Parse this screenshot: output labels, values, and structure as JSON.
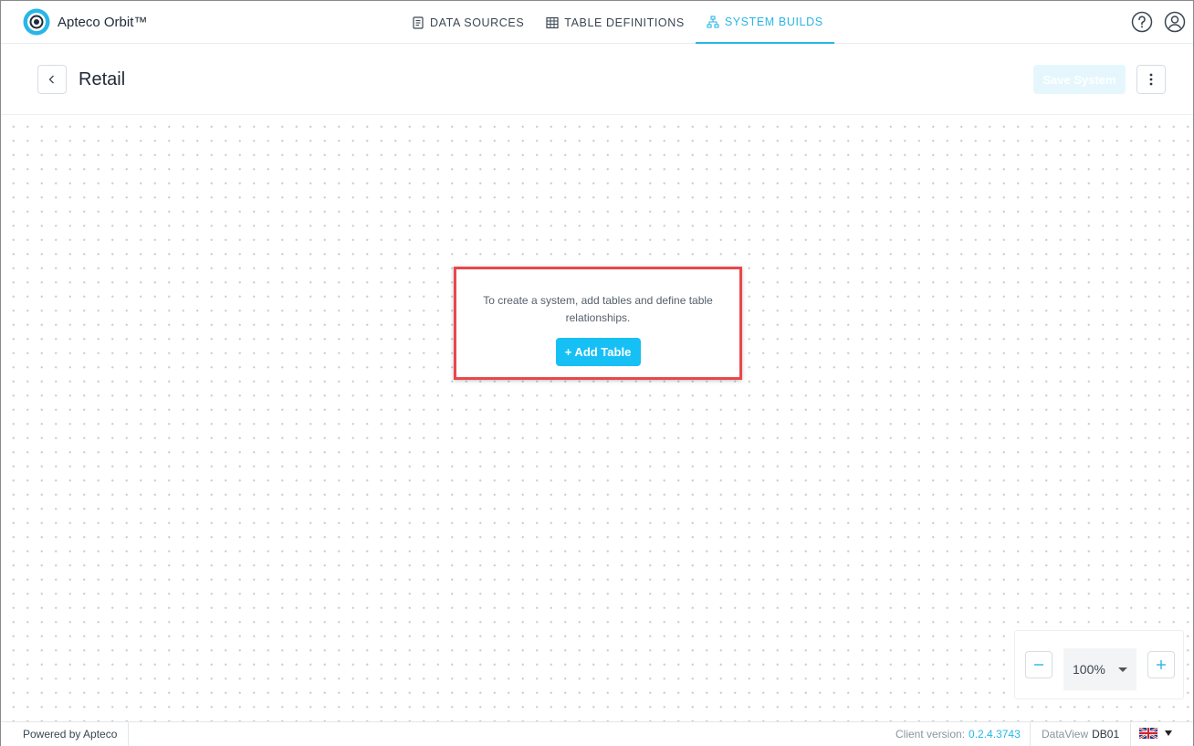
{
  "app": {
    "name": "Apteco Orbit™",
    "brand_color": "#29b6e6"
  },
  "nav": {
    "items": [
      {
        "label": "DATA SOURCES",
        "icon": "document-icon"
      },
      {
        "label": "TABLE DEFINITIONS",
        "icon": "table-grid-icon"
      },
      {
        "label": "SYSTEM BUILDS",
        "icon": "hierarchy-icon",
        "active": true
      }
    ]
  },
  "header_icons": [
    "help-icon",
    "user-account-icon"
  ],
  "page": {
    "title": "Retail",
    "save_label": "Save System"
  },
  "canvas": {
    "empty_message": "To create a system, add tables and define table relationships.",
    "add_table_label": "+ Add Table"
  },
  "zoom": {
    "value": "100%"
  },
  "footer": {
    "powered_by": "Powered by Apteco",
    "client_version_label": "Client version:",
    "client_version": "0.2.4.3743",
    "dataview_label": "DataView",
    "dataview_value": "DB01",
    "language_icon": "uk-flag-icon"
  }
}
